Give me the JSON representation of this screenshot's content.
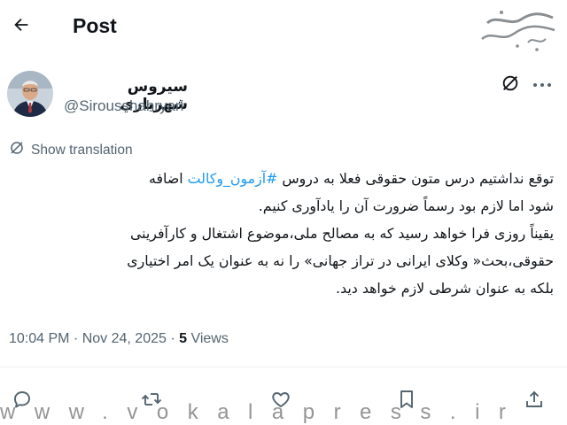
{
  "header": {
    "title": "Post",
    "back_icon": "arrow-left-icon",
    "watermark_logo_text": "وکلاپرس"
  },
  "author": {
    "display_name": "سيروس شهرياري",
    "handle": "@Sirousshahryari"
  },
  "translate": {
    "label": "Show translation",
    "icon": "globe-translate-icon"
  },
  "tweet": {
    "line1_before_hashtag": "توقع نداشتیم درس متون حقوقی فعلا به دروس ",
    "hashtag": "#آزمون_وکالت",
    "line1_after_hashtag": " اضافه",
    "line2": "شود اما لازم بود رسماً ضرورت آن را یادآوری کنیم.",
    "line3": "یقیناً روزی فرا خواهد رسید که به مصالح ملی،موضوع اشتغال و کارآفرینی",
    "line4": "حقوقی،بحث« وکلای ایرانی در تراز جهانی» را نه به عنوان یک امر اختیاری",
    "line5": "بلکه به عنوان شرطی لازم خواهد دید."
  },
  "meta": {
    "time": "10:04 PM",
    "separator1": " · ",
    "date": "Nov 24, 2025",
    "separator2": " · ",
    "views_count": "5",
    "views_label": " Views"
  },
  "actions": {
    "reply_icon": "reply-icon",
    "retweet_icon": "retweet-icon",
    "like_icon": "heart-icon",
    "bookmark_icon": "bookmark-icon",
    "share_icon": "share-icon"
  },
  "watermark": {
    "url": "www.vokalapress.ir"
  },
  "colors": {
    "text": "#0f1419",
    "secondary": "#536471",
    "accent": "#1d9bf0",
    "divider": "#eff3f4"
  }
}
